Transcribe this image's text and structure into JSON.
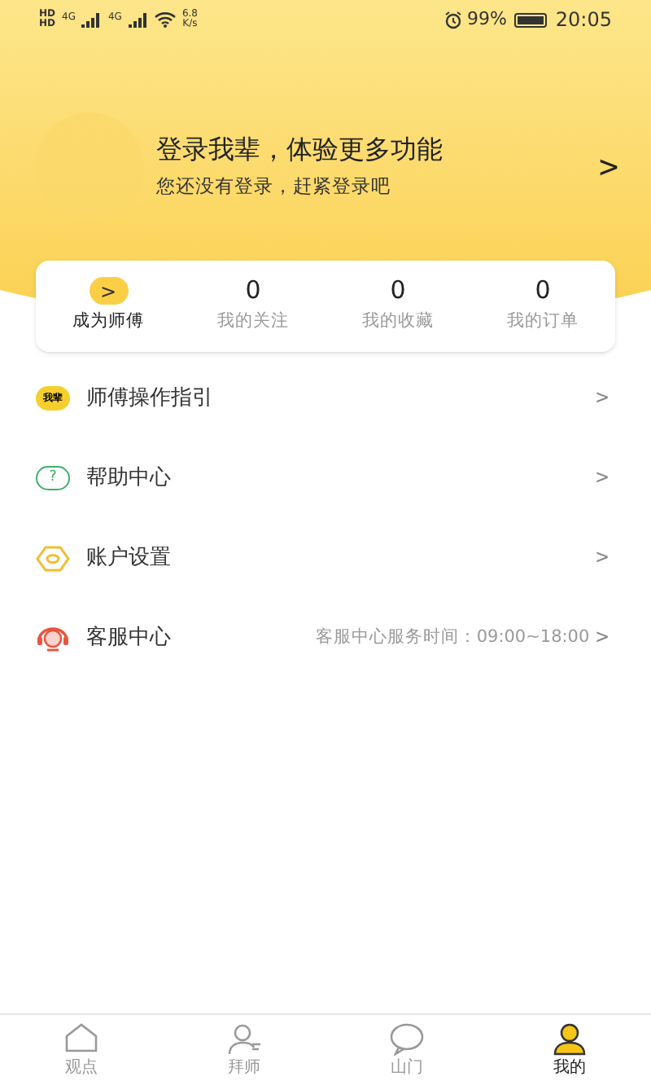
{
  "status_bar": {
    "sim_labels": [
      "HD",
      "HD"
    ],
    "networks": [
      "4G",
      "4G"
    ],
    "speed_value": "6.8",
    "speed_unit": "K/s",
    "battery": "99%",
    "time": "20:05"
  },
  "login": {
    "title": "登录我辈，体验更多功能",
    "subtitle": "您还没有登录，赶紧登录吧",
    "arrow": ">"
  },
  "stats": [
    {
      "kind": "action",
      "label": "成为师傅",
      "value": ">"
    },
    {
      "kind": "count",
      "label": "我的关注",
      "value": "0"
    },
    {
      "kind": "count",
      "label": "我的收藏",
      "value": "0"
    },
    {
      "kind": "count",
      "label": "我的订单",
      "value": "0"
    }
  ],
  "menu": [
    {
      "kind": "badge",
      "badge": "我辈",
      "label": "师傅操作指引",
      "arrow": ">"
    },
    {
      "kind": "help",
      "icon_text": "?",
      "label": "帮助中心",
      "arrow": ">"
    },
    {
      "kind": "settings",
      "label": "账户设置",
      "arrow": ">"
    },
    {
      "kind": "service",
      "label": "客服中心",
      "note": "客服中心服务时间：09:00~18:00",
      "arrow": ">"
    }
  ],
  "tabs": [
    {
      "kind": "home",
      "label": "观点",
      "selected": false
    },
    {
      "kind": "person",
      "label": "拜师",
      "selected": false
    },
    {
      "kind": "chat",
      "label": "山门",
      "selected": false
    },
    {
      "kind": "user",
      "label": "我的",
      "selected": true
    }
  ]
}
